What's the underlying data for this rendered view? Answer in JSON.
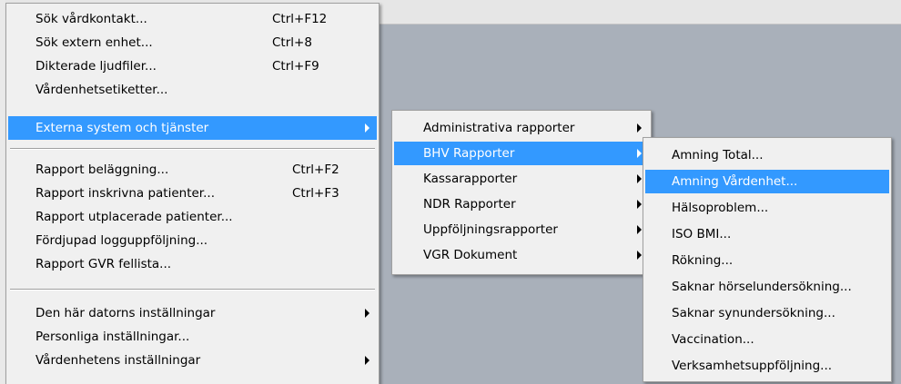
{
  "main_menu": {
    "items": [
      {
        "label": "Sök vårdkontakt...",
        "shortcut": "Ctrl+F12"
      },
      {
        "label": "Sök extern enhet...",
        "shortcut": "Ctrl+8"
      },
      {
        "label": "Dikterade ljudfiler...",
        "shortcut": "Ctrl+F9"
      },
      {
        "label": "Vårdenhetsetiketter..."
      },
      {
        "label": "Externa system och tjänster",
        "submenu": true,
        "highlighted": true
      },
      {
        "label": "Rapport beläggning...",
        "shortcut": "Ctrl+F2"
      },
      {
        "label": "Rapport inskrivna patienter...",
        "shortcut": "Ctrl+F3"
      },
      {
        "label": "Rapport utplacerade patienter..."
      },
      {
        "label": "Fördjupad logguppföljning..."
      },
      {
        "label": "Rapport GVR fellista..."
      },
      {
        "label": "Den här datorns inställningar",
        "submenu": true
      },
      {
        "label": "Personliga inställningar..."
      },
      {
        "label": "Vårdenhetens inställningar",
        "submenu": true
      }
    ]
  },
  "submenu_externa": {
    "items": [
      {
        "label": "Administrativa rapporter",
        "submenu": true
      },
      {
        "label": "BHV Rapporter",
        "submenu": true,
        "highlighted": true
      },
      {
        "label": "Kassarapporter",
        "submenu": true
      },
      {
        "label": "NDR Rapporter",
        "submenu": true
      },
      {
        "label": "Uppföljningsrapporter",
        "submenu": true
      },
      {
        "label": "VGR Dokument",
        "submenu": true
      }
    ]
  },
  "submenu_bhv": {
    "items": [
      {
        "label": "Amning Total..."
      },
      {
        "label": "Amning Vårdenhet...",
        "highlighted": true
      },
      {
        "label": "Hälsoproblem..."
      },
      {
        "label": "ISO BMI..."
      },
      {
        "label": "Rökning..."
      },
      {
        "label": "Saknar hörselundersökning..."
      },
      {
        "label": "Saknar synundersökning..."
      },
      {
        "label": "Vaccination..."
      },
      {
        "label": "Verksamhetsuppföljning..."
      }
    ]
  },
  "colors": {
    "highlight": "#3399ff",
    "menu_background": "#f0f0f0",
    "workspace": "#a9b0ba"
  },
  "icons": {
    "submenu_arrow": "chevron-right-icon"
  }
}
